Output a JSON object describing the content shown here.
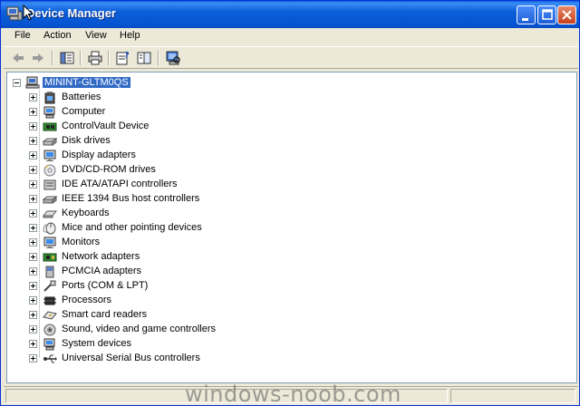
{
  "window": {
    "title": "Device Manager"
  },
  "menu": [
    "File",
    "Action",
    "View",
    "Help"
  ],
  "toolbar": {
    "icons": [
      "back-arrow-icon",
      "forward-arrow-icon",
      "show-hide-tree-icon",
      "print-icon",
      "properties-icon",
      "help-icon",
      "scan-hardware-icon"
    ]
  },
  "tree": {
    "root": "MININT-GLTM0QS",
    "categories": [
      {
        "label": "Batteries",
        "icon": "battery-icon"
      },
      {
        "label": "Computer",
        "icon": "computer-icon"
      },
      {
        "label": "ControlVault Device",
        "icon": "chip-board-icon"
      },
      {
        "label": "Disk drives",
        "icon": "disk-drive-icon"
      },
      {
        "label": "Display adapters",
        "icon": "monitor-icon"
      },
      {
        "label": "DVD/CD-ROM drives",
        "icon": "cd-icon"
      },
      {
        "label": "IDE ATA/ATAPI controllers",
        "icon": "ide-controller-icon"
      },
      {
        "label": "IEEE 1394 Bus host controllers",
        "icon": "ieee1394-icon"
      },
      {
        "label": "Keyboards",
        "icon": "keyboard-icon"
      },
      {
        "label": "Mice and other pointing devices",
        "icon": "mouse-icon"
      },
      {
        "label": "Monitors",
        "icon": "monitor-icon"
      },
      {
        "label": "Network adapters",
        "icon": "network-card-icon"
      },
      {
        "label": "PCMCIA adapters",
        "icon": "pcmcia-icon"
      },
      {
        "label": "Ports (COM & LPT)",
        "icon": "port-icon"
      },
      {
        "label": "Processors",
        "icon": "processor-icon"
      },
      {
        "label": "Smart card readers",
        "icon": "smart-card-icon"
      },
      {
        "label": "Sound, video and game controllers",
        "icon": "speaker-icon"
      },
      {
        "label": "System devices",
        "icon": "system-device-icon"
      },
      {
        "label": "Universal Serial Bus controllers",
        "icon": "usb-icon"
      }
    ]
  },
  "watermark": "windows-noob.com",
  "colors": {
    "titlebar": "#0a5fd8",
    "selection": "#316ac5",
    "chrome": "#ece9d8"
  }
}
